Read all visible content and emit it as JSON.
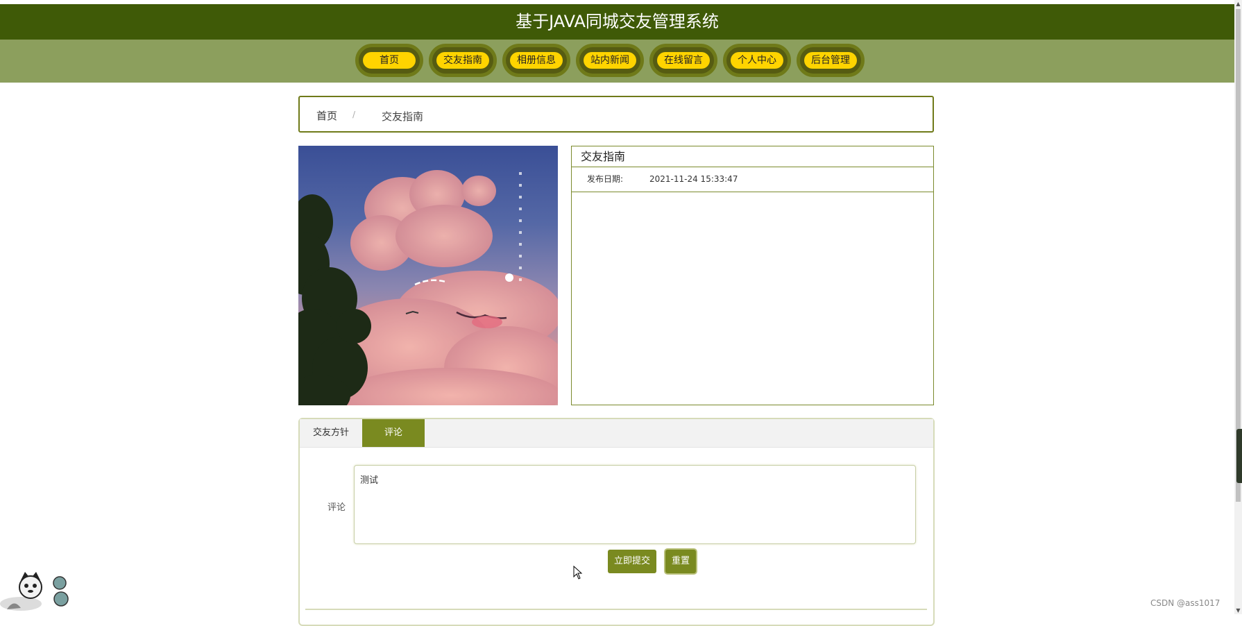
{
  "header": {
    "title": "基于JAVA同城交友管理系统"
  },
  "nav": {
    "items": [
      {
        "label": "首页"
      },
      {
        "label": "交友指南"
      },
      {
        "label": "相册信息"
      },
      {
        "label": "站内新闻"
      },
      {
        "label": "在线留言"
      },
      {
        "label": "个人中心"
      },
      {
        "label": "后台管理"
      }
    ]
  },
  "breadcrumb": {
    "home": "首页",
    "separator": "/",
    "current": "交友指南"
  },
  "detail": {
    "title": "交友指南",
    "date_label": "发布日期:",
    "date_value": "2021-11-24 15:33:47"
  },
  "tabs": [
    {
      "label": "交友方针",
      "active": false
    },
    {
      "label": "评论",
      "active": true
    }
  ],
  "comment": {
    "label": "评论",
    "value": "测试"
  },
  "buttons": {
    "submit": "立即提交",
    "reset": "重置"
  },
  "watermark": "CSDN @ass1017",
  "colors": {
    "header_bg": "#3f5a07",
    "nav_bg": "#8c9f5d",
    "nav_pill": "#ffd400",
    "accent": "#7a8a20"
  }
}
